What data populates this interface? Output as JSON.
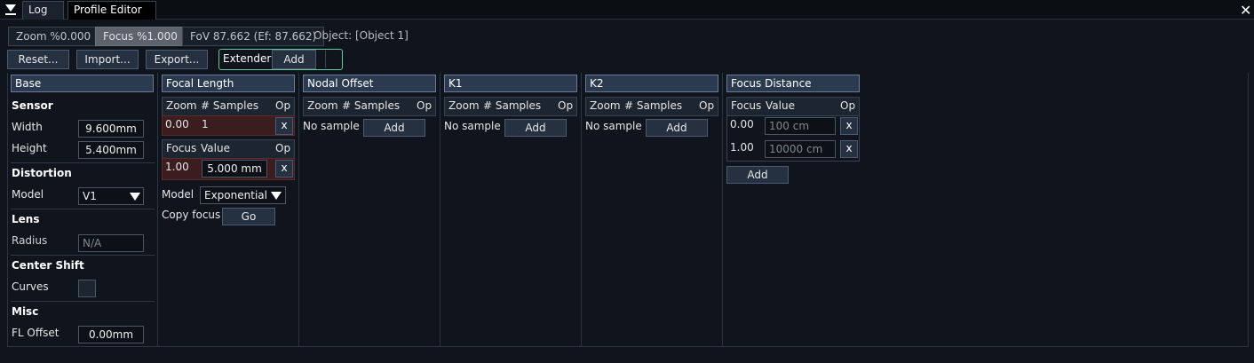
{
  "tabs": [
    {
      "label": "Log"
    },
    {
      "label": "Profile Editor"
    }
  ],
  "toolbar": {
    "zoom": "Zoom %0.000",
    "focus": "Focus %1.000",
    "fov": "FoV 87.662 (Ef: 87.662)",
    "object": "Object: [Object 1]",
    "reset": "Reset...",
    "import": "Import...",
    "export": "Export...",
    "extender": "Extender",
    "add": "Add"
  },
  "base": {
    "header": "Base",
    "sensor": "Sensor",
    "width_label": "Width",
    "width_value": "9.600mm",
    "height_label": "Height",
    "height_value": "5.400mm",
    "distortion": "Distortion",
    "model_label": "Model",
    "model_value": "V1",
    "lens": "Lens",
    "radius_label": "Radius",
    "radius_value": "N/A",
    "center_shift": "Center Shift",
    "curves_label": "Curves",
    "misc": "Misc",
    "fl_offset_label": "FL Offset",
    "fl_offset_value": "0.00mm"
  },
  "focal": {
    "header": "Focal Length",
    "col_zoom": "Zoom",
    "col_samples": "# Samples",
    "col_op": "Op",
    "row_zoom": "0.00",
    "row_samples": "1",
    "col_focus": "Focus",
    "col_value": "Value",
    "row_focus": "1.00",
    "row_value": "5.000 mm",
    "x": "x",
    "model_label": "Model",
    "model_value": "Exponential",
    "copy_focus": "Copy focus",
    "go": "Go"
  },
  "nodal": {
    "header": "Nodal Offset",
    "no_sample": "No sample",
    "add": "Add"
  },
  "k1": {
    "header": "K1",
    "no_sample": "No sample",
    "add": "Add"
  },
  "k2": {
    "header": "K2",
    "no_sample": "No sample",
    "add": "Add"
  },
  "focus_distance": {
    "header": "Focus Distance",
    "col_focus": "Focus",
    "col_value": "Value",
    "col_op": "Op",
    "rows": [
      {
        "focus": "0.00",
        "value": "100 cm"
      },
      {
        "focus": "1.00",
        "value": "10000 cm"
      }
    ],
    "x": "x",
    "add": "Add"
  },
  "close": "✕"
}
